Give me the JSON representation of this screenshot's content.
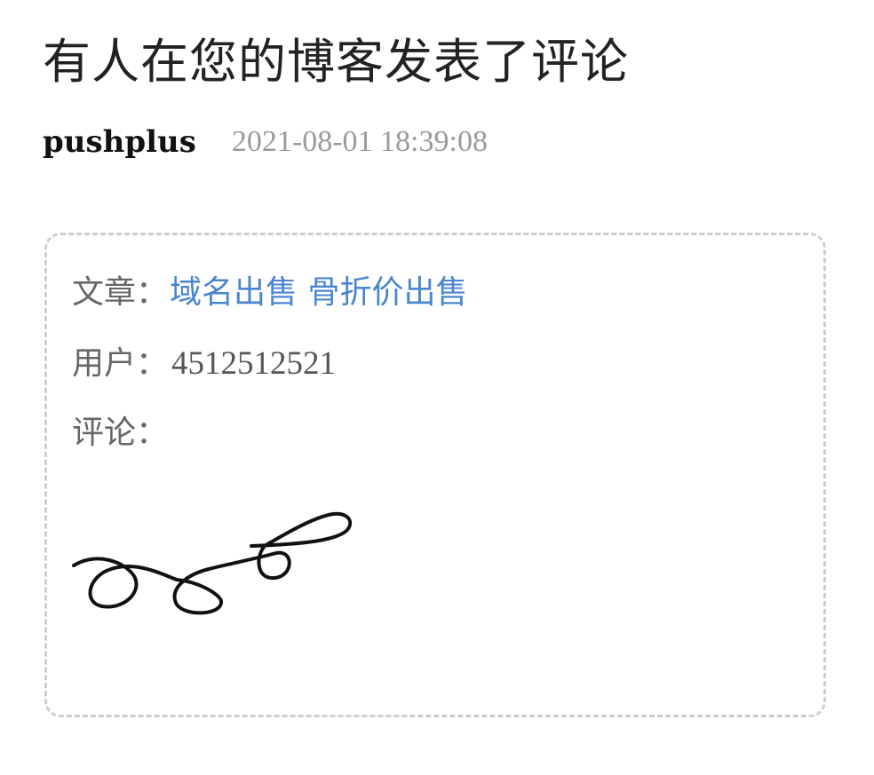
{
  "header": {
    "title": "有人在您的博客发表了评论",
    "sender": "pushplus",
    "timestamp": "2021-08-01 18:39:08"
  },
  "card": {
    "article_label": "文章：",
    "article_title": "域名出售 骨折价出售",
    "user_label": "用户：",
    "user_value": "4512512521",
    "comment_label": "评论："
  },
  "colors": {
    "title": "#222222",
    "link": "#4a86cf",
    "timestamp": "#9a9a9a",
    "border": "#cfcfcf",
    "label": "#666666"
  },
  "icons": {
    "comment_content": "handwritten-scribble"
  }
}
